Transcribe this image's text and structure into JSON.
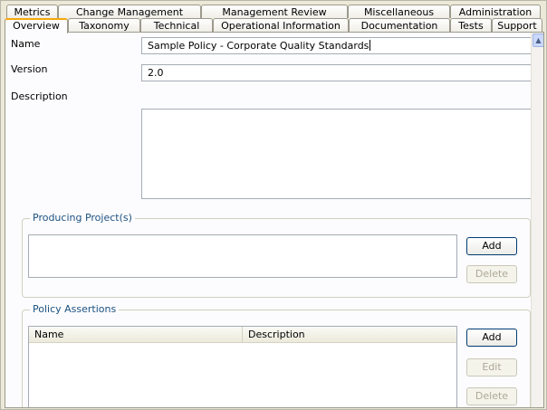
{
  "tabs": {
    "top_row": [
      "Metrics",
      "Change Management",
      "Management Review",
      "Miscellaneous",
      "Administration"
    ],
    "bottom_row": [
      "Overview",
      "Taxonomy",
      "Technical",
      "Operational Information",
      "Documentation",
      "Tests",
      "Support"
    ],
    "active": "Overview"
  },
  "form": {
    "name_label": "Name",
    "name_value": "Sample Policy - Corporate Quality Standards",
    "version_label": "Version",
    "version_value": "2.0",
    "description_label": "Description",
    "description_value": ""
  },
  "producing_projects": {
    "title": "Producing Project(s)",
    "add_label": "Add",
    "delete_label": "Delete"
  },
  "policy_assertions": {
    "title": "Policy Assertions",
    "columns": [
      "Name",
      "Description"
    ],
    "add_label": "Add",
    "edit_label": "Edit",
    "delete_label": "Delete"
  },
  "colors": {
    "active_tab_accent": "#f6a90a",
    "group_title": "#1c5180",
    "button_border": "#003c74"
  }
}
